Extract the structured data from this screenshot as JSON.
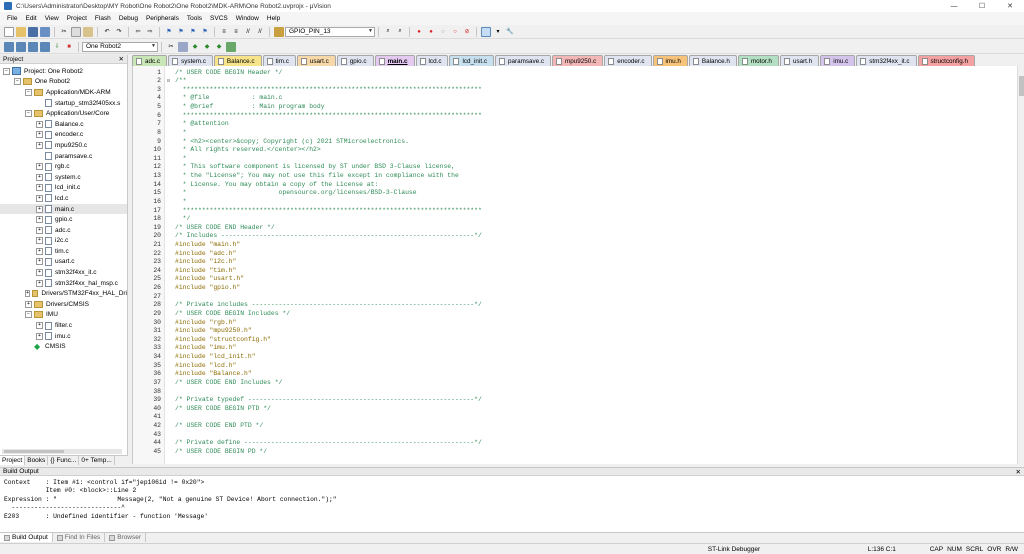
{
  "window": {
    "title": "C:\\Users\\Administrator\\Desktop\\MY Robot\\One Robot2\\One Robot2\\MDK-ARM\\One Robot2.uvprojx - µVision"
  },
  "menu": [
    "File",
    "Edit",
    "View",
    "Project",
    "Flash",
    "Debug",
    "Peripherals",
    "Tools",
    "SVCS",
    "Window",
    "Help"
  ],
  "toolbar": {
    "find_value": "GPIO_PIN_13",
    "target_value": "One Robot2"
  },
  "project_panel": {
    "title": "Project",
    "tree": [
      {
        "label": "Project: One Robot2",
        "depth": 0,
        "expander": "−",
        "icon": "project-icon"
      },
      {
        "label": "One Robot2",
        "depth": 1,
        "expander": "−",
        "icon": "target-folder-icon"
      },
      {
        "label": "Application/MDK-ARM",
        "depth": 2,
        "expander": "−",
        "icon": "folder-icon"
      },
      {
        "label": "startup_stm32f405xx.s",
        "depth": 3,
        "expander": "",
        "icon": "file-icon"
      },
      {
        "label": "Application/User/Core",
        "depth": 2,
        "expander": "−",
        "icon": "folder-icon"
      },
      {
        "label": "Balance.c",
        "depth": 3,
        "expander": "+",
        "icon": "file-icon"
      },
      {
        "label": "encoder.c",
        "depth": 3,
        "expander": "+",
        "icon": "file-icon"
      },
      {
        "label": "mpu9250.c",
        "depth": 3,
        "expander": "+",
        "icon": "file-icon"
      },
      {
        "label": "paramsave.c",
        "depth": 3,
        "expander": "",
        "icon": "file-icon"
      },
      {
        "label": "rgb.c",
        "depth": 3,
        "expander": "+",
        "icon": "file-icon"
      },
      {
        "label": "system.c",
        "depth": 3,
        "expander": "+",
        "icon": "file-icon"
      },
      {
        "label": "lcd_init.c",
        "depth": 3,
        "expander": "+",
        "icon": "file-icon"
      },
      {
        "label": "lcd.c",
        "depth": 3,
        "expander": "+",
        "icon": "file-icon"
      },
      {
        "label": "main.c",
        "depth": 3,
        "expander": "+",
        "icon": "file-icon",
        "selected": true
      },
      {
        "label": "gpio.c",
        "depth": 3,
        "expander": "+",
        "icon": "file-icon"
      },
      {
        "label": "adc.c",
        "depth": 3,
        "expander": "+",
        "icon": "file-icon"
      },
      {
        "label": "i2c.c",
        "depth": 3,
        "expander": "+",
        "icon": "file-icon"
      },
      {
        "label": "tim.c",
        "depth": 3,
        "expander": "+",
        "icon": "file-icon"
      },
      {
        "label": "usart.c",
        "depth": 3,
        "expander": "+",
        "icon": "file-icon"
      },
      {
        "label": "stm32f4xx_it.c",
        "depth": 3,
        "expander": "+",
        "icon": "file-icon"
      },
      {
        "label": "stm32f4xx_hal_msp.c",
        "depth": 3,
        "expander": "+",
        "icon": "file-icon"
      },
      {
        "label": "Drivers/STM32F4xx_HAL_Dri",
        "depth": 2,
        "expander": "+",
        "icon": "folder-icon"
      },
      {
        "label": "Drivers/CMSIS",
        "depth": 2,
        "expander": "+",
        "icon": "folder-icon"
      },
      {
        "label": "IMU",
        "depth": 2,
        "expander": "−",
        "icon": "folder-icon"
      },
      {
        "label": "filter.c",
        "depth": 3,
        "expander": "+",
        "icon": "file-icon"
      },
      {
        "label": "imu.c",
        "depth": 3,
        "expander": "+",
        "icon": "file-icon"
      },
      {
        "label": "CMSIS",
        "depth": 2,
        "expander": "",
        "icon": "cmsis-gem-icon"
      }
    ],
    "tabs": [
      "Project",
      "Books",
      "{} Func...",
      "0+ Temp..."
    ]
  },
  "editor_tabs": [
    {
      "label": "adc.c",
      "color": "#c9e6b7"
    },
    {
      "label": "system.c",
      "color": "#dfe4f0"
    },
    {
      "label": "Balance.c",
      "color": "#f7e48a"
    },
    {
      "label": "tim.c",
      "color": "#dfe4f0"
    },
    {
      "label": "usart.c",
      "color": "#f7d9a9"
    },
    {
      "label": "gpio.c",
      "color": "#dfe4f0"
    },
    {
      "label": "main.c",
      "color": "#e4c9f0",
      "active": true
    },
    {
      "label": "lcd.c",
      "color": "#dfe4f0"
    },
    {
      "label": "lcd_init.c",
      "color": "#c7e0ef"
    },
    {
      "label": "paramsave.c",
      "color": "#dfe4f0"
    },
    {
      "label": "mpu9250.c",
      "color": "#f3b7b7"
    },
    {
      "label": "encoder.c",
      "color": "#dfe4f0"
    },
    {
      "label": "imu.h",
      "color": "#f7c27a"
    },
    {
      "label": "Balance.h",
      "color": "#dfe4f0"
    },
    {
      "label": "motor.h",
      "color": "#b3dfc2"
    },
    {
      "label": "usart.h",
      "color": "#dfe4f0"
    },
    {
      "label": "imu.c",
      "color": "#d4c4ec"
    },
    {
      "label": "stm32f4xx_it.c",
      "color": "#dfe4f0"
    },
    {
      "label": "structconfig.h",
      "color": "#f3a1a1"
    }
  ],
  "code_lines": [
    {
      "n": "1",
      "fold": "",
      "t": "/* USER CODE BEGIN Header */",
      "c": "comment"
    },
    {
      "n": "2",
      "fold": "⊟",
      "t": "/**",
      "c": "comment"
    },
    {
      "n": "3",
      "fold": "",
      "t": "  ******************************************************************************",
      "c": "comment"
    },
    {
      "n": "4",
      "fold": "",
      "t": "  * @file           : main.c",
      "c": "comment"
    },
    {
      "n": "5",
      "fold": "",
      "t": "  * @brief          : Main program body",
      "c": "comment"
    },
    {
      "n": "6",
      "fold": "",
      "t": "  ******************************************************************************",
      "c": "comment"
    },
    {
      "n": "7",
      "fold": "",
      "t": "  * @attention",
      "c": "comment"
    },
    {
      "n": "8",
      "fold": "",
      "t": "  *",
      "c": "comment"
    },
    {
      "n": "9",
      "fold": "",
      "t": "  * <h2><center>&copy; Copyright (c) 2021 STMicroelectronics.",
      "c": "comment"
    },
    {
      "n": "10",
      "fold": "",
      "t": "  * All rights reserved.</center></h2>",
      "c": "comment"
    },
    {
      "n": "11",
      "fold": "",
      "t": "  *",
      "c": "comment"
    },
    {
      "n": "12",
      "fold": "",
      "t": "  * This software component is licensed by ST under BSD 3-Clause license,",
      "c": "comment"
    },
    {
      "n": "13",
      "fold": "",
      "t": "  * the \"License\"; You may not use this file except in compliance with the",
      "c": "comment"
    },
    {
      "n": "14",
      "fold": "",
      "t": "  * License. You may obtain a copy of the License at:",
      "c": "comment"
    },
    {
      "n": "15",
      "fold": "",
      "t": "  *                        opensource.org/licenses/BSD-3-Clause",
      "c": "comment"
    },
    {
      "n": "16",
      "fold": "",
      "t": "  *",
      "c": "comment"
    },
    {
      "n": "17",
      "fold": "",
      "t": "  ******************************************************************************",
      "c": "comment"
    },
    {
      "n": "18",
      "fold": "",
      "t": "  */",
      "c": "comment"
    },
    {
      "n": "19",
      "fold": "",
      "t": "/* USER CODE END Header */",
      "c": "comment"
    },
    {
      "n": "20",
      "fold": "",
      "t": "/* Includes ------------------------------------------------------------------*/",
      "c": "comment"
    },
    {
      "n": "21",
      "fold": "",
      "t": "#include \"main.h\"",
      "c": "pre"
    },
    {
      "n": "22",
      "fold": "",
      "t": "#include \"adc.h\"",
      "c": "pre"
    },
    {
      "n": "23",
      "fold": "",
      "t": "#include \"i2c.h\"",
      "c": "pre"
    },
    {
      "n": "24",
      "fold": "",
      "t": "#include \"tim.h\"",
      "c": "pre"
    },
    {
      "n": "25",
      "fold": "",
      "t": "#include \"usart.h\"",
      "c": "pre"
    },
    {
      "n": "26",
      "fold": "",
      "t": "#include \"gpio.h\"",
      "c": "pre"
    },
    {
      "n": "27",
      "fold": "",
      "t": "",
      "c": "plain"
    },
    {
      "n": "28",
      "fold": "",
      "t": "/* Private includes ----------------------------------------------------------*/",
      "c": "comment"
    },
    {
      "n": "29",
      "fold": "",
      "t": "/* USER CODE BEGIN Includes */",
      "c": "comment"
    },
    {
      "n": "30",
      "fold": "",
      "t": "#include \"rgb.h\"",
      "c": "pre"
    },
    {
      "n": "31",
      "fold": "",
      "t": "#include \"mpu9250.h\"",
      "c": "pre"
    },
    {
      "n": "32",
      "fold": "",
      "t": "#include \"structconfig.h\"",
      "c": "pre"
    },
    {
      "n": "33",
      "fold": "",
      "t": "#include \"imu.h\"",
      "c": "pre"
    },
    {
      "n": "34",
      "fold": "",
      "t": "#include \"lcd_init.h\"",
      "c": "pre"
    },
    {
      "n": "35",
      "fold": "",
      "t": "#include \"lcd.h\"",
      "c": "pre"
    },
    {
      "n": "36",
      "fold": "",
      "t": "#include \"Balance.h\"",
      "c": "pre"
    },
    {
      "n": "37",
      "fold": "",
      "t": "/* USER CODE END Includes */",
      "c": "comment"
    },
    {
      "n": "38",
      "fold": "",
      "t": "",
      "c": "plain"
    },
    {
      "n": "39",
      "fold": "",
      "t": "/* Private typedef -----------------------------------------------------------*/",
      "c": "comment"
    },
    {
      "n": "40",
      "fold": "",
      "t": "/* USER CODE BEGIN PTD */",
      "c": "comment"
    },
    {
      "n": "41",
      "fold": "",
      "t": "",
      "c": "plain"
    },
    {
      "n": "42",
      "fold": "",
      "t": "/* USER CODE END PTD */",
      "c": "comment"
    },
    {
      "n": "43",
      "fold": "",
      "t": "",
      "c": "plain"
    },
    {
      "n": "44",
      "fold": "",
      "t": "/* Private define ------------------------------------------------------------*/",
      "c": "comment"
    },
    {
      "n": "45",
      "fold": "",
      "t": "/* USER CODE BEGIN PD */",
      "c": "comment"
    }
  ],
  "syntax_colors": {
    "comment": "#2e8b57",
    "pre": "#8b6b00",
    "plain": "#000000"
  },
  "build_output": {
    "title": "Build Output",
    "lines": [
      "Context    : Item #1: <control if=\"jep106id != 0x20\">",
      "           Item #0: <block>::Line 2",
      "Expression : \"                Message(2, \"Not a genuine ST Device! Abort connection.\");\"",
      "  -----------------------------^",
      "E203       : Undefined identifier - function 'Message'"
    ],
    "tabs": [
      "Build Output",
      "Find In Files",
      "Browser"
    ]
  },
  "status": {
    "debugger": "ST-Link Debugger",
    "position": "L:136 C:1",
    "caps": "CAP",
    "num": "NUM",
    "scrl": "SCRL",
    "ovr": "OVR",
    "rw": "R/W"
  }
}
